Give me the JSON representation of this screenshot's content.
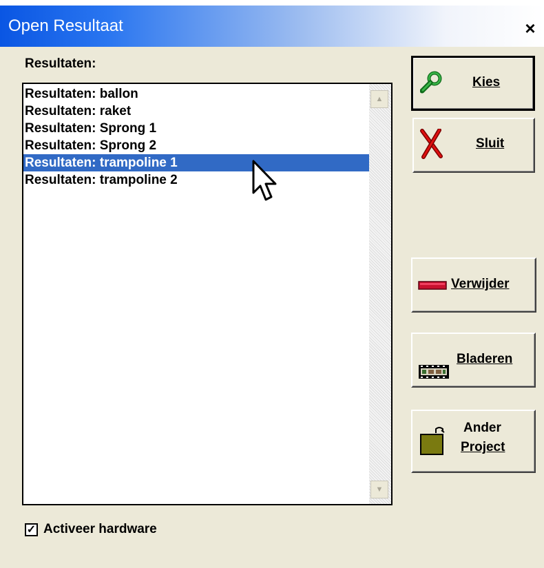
{
  "window": {
    "title": "Open Resultaat",
    "close_symbol": "×"
  },
  "list": {
    "label": "Resultaten:",
    "items": [
      "Resultaten: ballon",
      "Resultaten: raket",
      "Resultaten: Sprong 1",
      "Resultaten: Sprong 2",
      "Resultaten: trampoline 1",
      "Resultaten: trampoline 2"
    ],
    "selected_index": 4
  },
  "buttons": {
    "kies": {
      "mnemonic": "K",
      "rest": "ies",
      "icon": "green-magnifier-icon"
    },
    "sluit": {
      "mnemonic": "S",
      "rest": "luit",
      "icon": "red-x-icon"
    },
    "verwijder": {
      "mnemonic": "V",
      "rest": "erwijder",
      "icon": "red-bar-icon"
    },
    "bladeren": {
      "mnemonic": "B",
      "rest": "laderen",
      "icon": "film-strip-icon"
    },
    "ander_project": {
      "line1": "Ander",
      "mnemonic": "P",
      "rest": "roject",
      "icon": "folder-icon"
    }
  },
  "checkbox": {
    "label": "Activeer hardware",
    "checked": true,
    "mark": "✓"
  },
  "colors": {
    "selection": "#316ac5",
    "titlebar": "#0a56e3",
    "face": "#ece9d8"
  }
}
